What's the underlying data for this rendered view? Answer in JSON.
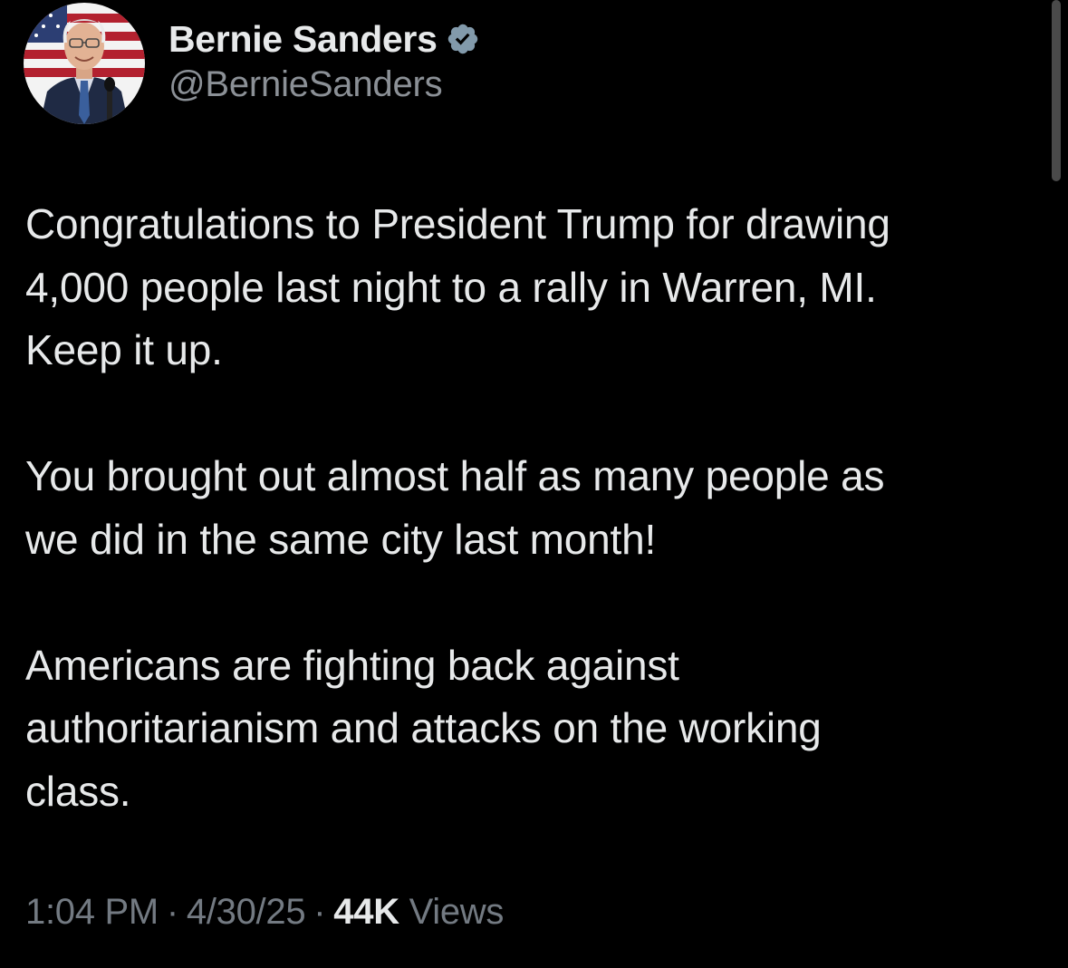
{
  "colors": {
    "background": "#000000",
    "primary_text": "#e7e9ea",
    "secondary_text": "#8b9096",
    "verified_badge": "#829aab"
  },
  "author": {
    "display_name": "Bernie Sanders",
    "handle": "@BernieSanders",
    "verified_icon": "verified-badge-icon",
    "avatar": "avatar"
  },
  "tweet": {
    "paragraphs": [
      "Congratulations to President Trump for drawing\n4,000 people last night to a rally in Warren, MI.\nKeep it up.",
      "You brought out almost half as many people as\nwe did in the same city last month!",
      "Americans are fighting back against\nauthoritarianism and attacks on the working\nclass."
    ]
  },
  "meta": {
    "time": "1:04 PM",
    "separator": "·",
    "date": "4/30/25",
    "views_count": "44K",
    "views_label": "Views"
  }
}
